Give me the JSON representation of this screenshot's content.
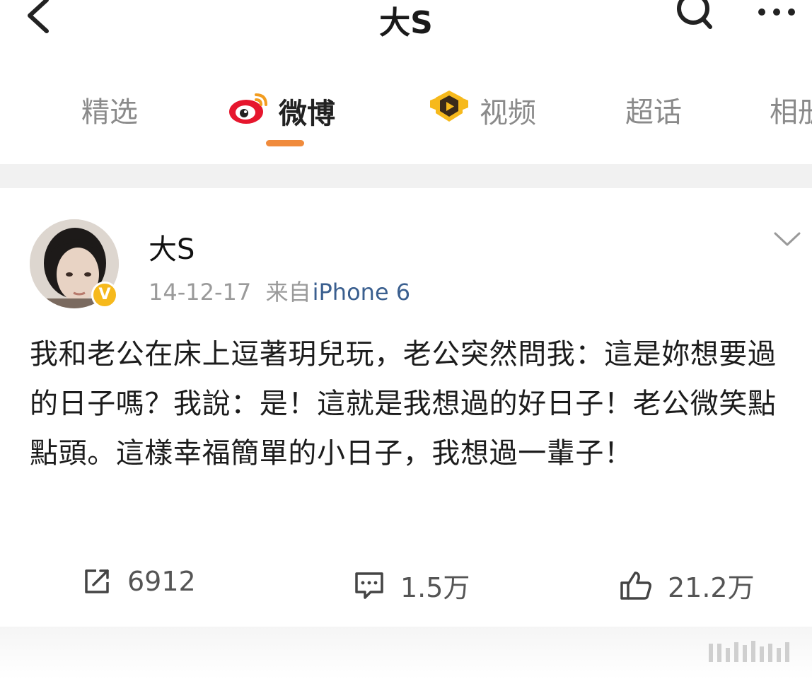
{
  "header": {
    "title": "大S",
    "back_icon": "back-arrow-icon",
    "search_icon": "search-icon",
    "more_icon": "more-icon"
  },
  "tabs": [
    {
      "label": "精选",
      "active": false
    },
    {
      "label": "微博",
      "active": true,
      "icon": "weibo-logo-icon"
    },
    {
      "label": "视频",
      "active": false,
      "icon": "video-badge-icon"
    },
    {
      "label": "超话",
      "active": false
    },
    {
      "label": "相册",
      "active": false
    }
  ],
  "post": {
    "author": "大S",
    "date": "14-12-17",
    "source_prefix": "来自",
    "source": "iPhone 6",
    "text": "我和老公在床上逗著玥兒玩，老公突然問我：這是妳想要過的日子嗎？我說：是！這就是我想過的好日子！老公微笑點點頭。這樣幸福簡單的小日子，我想過一輩子！",
    "verified_badge": "V",
    "actions": {
      "repost": "6912",
      "comment": "1.5万",
      "like": "21.2万"
    }
  },
  "colors": {
    "accent_orange": "#f08b3c",
    "verified_gold": "#f6b91c",
    "source_blue": "#3a5f8f",
    "divider_gray": "#f1f1f1"
  }
}
